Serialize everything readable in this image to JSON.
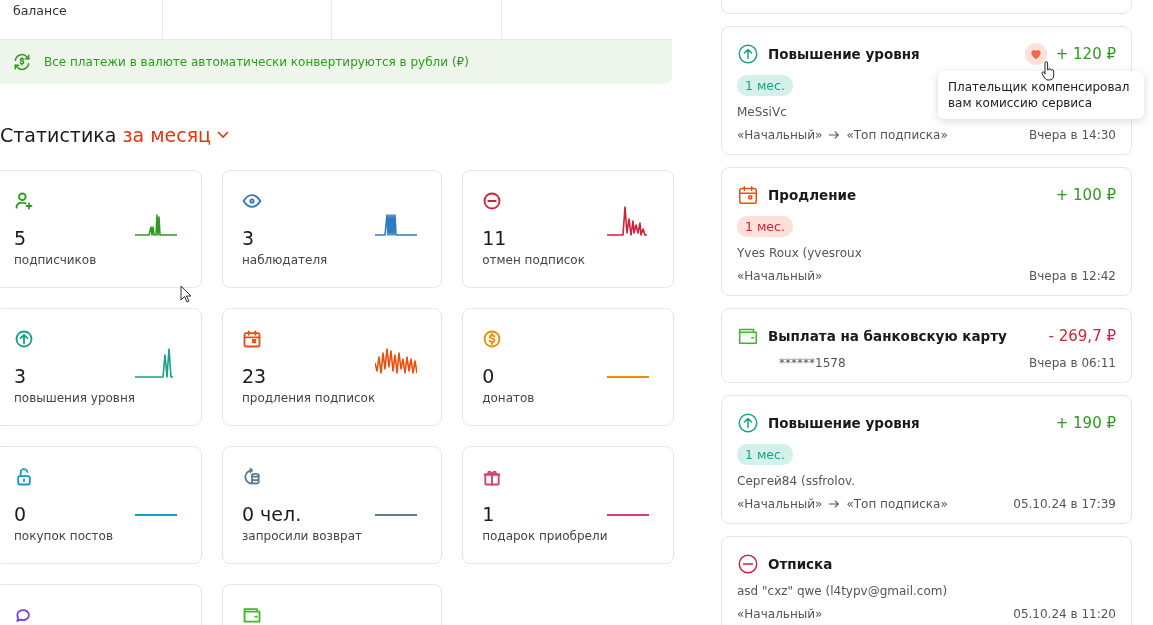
{
  "balance_strip": {
    "cells": [
      {
        "label": "балансе"
      },
      {},
      {},
      {}
    ]
  },
  "currency_notice": {
    "text": "Все платежи в валюте автоматически конвертируются в рубли (₽)"
  },
  "statistics": {
    "title": "Статистика",
    "period": "за месяц",
    "cards": [
      {
        "kind": "subscribers",
        "color": "#2e9a1e",
        "value": "5",
        "label": "подписчиков"
      },
      {
        "kind": "watchers",
        "color": "#2f7bbd",
        "value": "3",
        "label": "наблюдателя"
      },
      {
        "kind": "cancellations",
        "color": "#d0213b",
        "value": "11",
        "label": "отмен подписок"
      },
      {
        "kind": "upgrades",
        "color": "#17a386",
        "value": "3",
        "label": "повышения уровня"
      },
      {
        "kind": "renewals",
        "color": "#e8500f",
        "value": "23",
        "label": "продления подписок"
      },
      {
        "kind": "donations",
        "color": "#f08c00",
        "value": "0",
        "label": "донатов"
      },
      {
        "kind": "posts",
        "color": "#1a9bbf",
        "value": "0",
        "label": "покупок постов"
      },
      {
        "kind": "refunds",
        "color": "#5d7a8f",
        "value": "0 чел.",
        "label": "запросили возврат"
      },
      {
        "kind": "gifts",
        "color": "#d2426a",
        "value": "1",
        "label": "подарок приобрели"
      },
      {
        "kind": "comments",
        "color": "#7a3fe0"
      },
      {
        "kind": "payouts",
        "color": "#3cb924"
      }
    ]
  },
  "transactions": [
    {
      "kind": "upgrade",
      "title": "Повышение уровня",
      "compensated": true,
      "tooltip": "Плательщик компенсировал вам комиссию сервиса",
      "amount": "+ 120 ₽",
      "badge": "1 мес.",
      "payer": "MeSsiVc",
      "plan_from": "«Начальный»",
      "plan_to": "«Топ подписка»",
      "time": "Вчера в 14:30"
    },
    {
      "kind": "renewal",
      "title": "Продление",
      "compensated": false,
      "amount": "+ 100 ₽",
      "badge": "1 мес.",
      "payer": "Yves Roux (yvesroux",
      "plan_from": "«Начальный»",
      "time": "Вчера в 12:42"
    },
    {
      "kind": "payout",
      "title": "Выплата на банковскую карту",
      "compensated": false,
      "amount": "- 269,7 ₽",
      "card": "******1578",
      "time": "Вчера в 06:11"
    },
    {
      "kind": "upgrade",
      "title": "Повышение уровня",
      "compensated": false,
      "amount": "+ 190 ₽",
      "badge": "1 мес.",
      "payer": "Сергей84 (ssfrolov.",
      "plan_from": "«Начальный»",
      "plan_to": "«Топ подписка»",
      "time": "05.10.24 в 17:39"
    },
    {
      "kind": "unsubscribe",
      "title": "Отписка",
      "compensated": false,
      "payer": "asd \"cxz\" qwe (l4typv@gmail.com)",
      "plan_from": "«Начальный»",
      "time": "05.10.24 в 11:20"
    }
  ]
}
